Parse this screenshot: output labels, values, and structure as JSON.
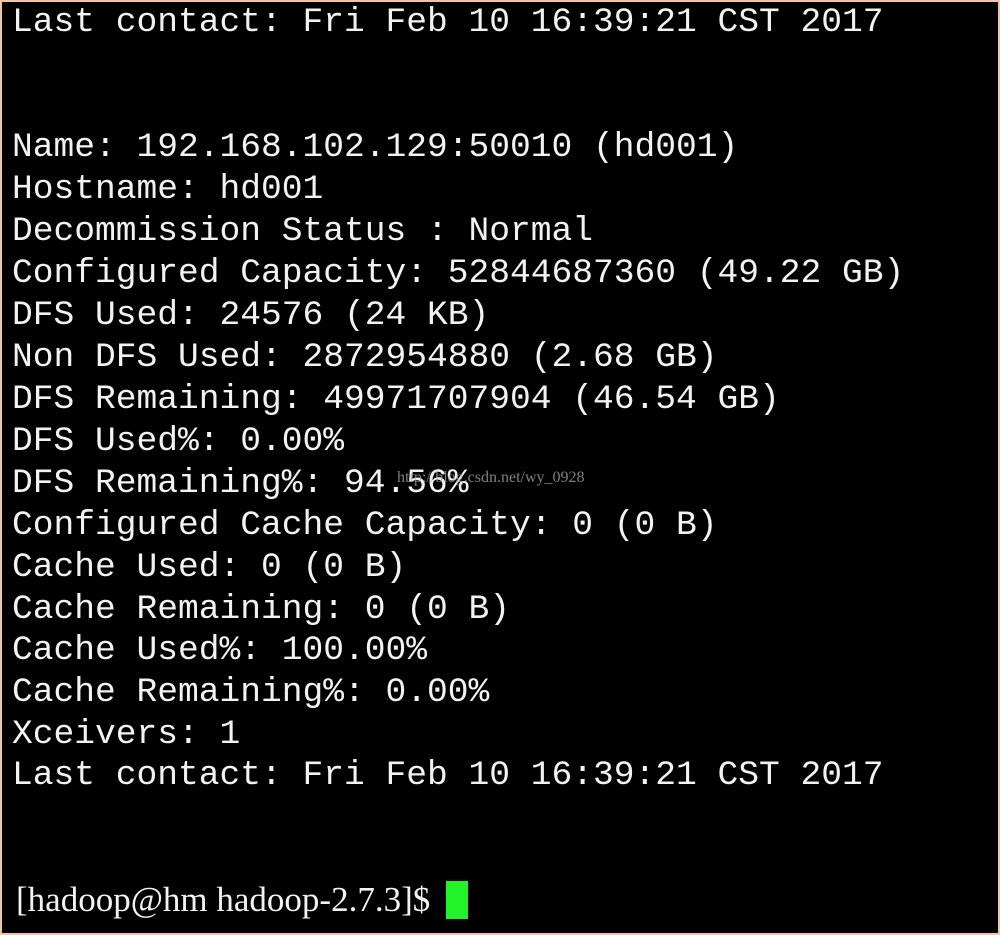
{
  "terminal": {
    "lines": [
      "Last contact: Fri Feb 10 16:39:21 CST 2017",
      "",
      "",
      "Name: 192.168.102.129:50010 (hd001)",
      "Hostname: hd001",
      "Decommission Status : Normal",
      "Configured Capacity: 52844687360 (49.22 GB)",
      "DFS Used: 24576 (24 KB)",
      "Non DFS Used: 2872954880 (2.68 GB)",
      "DFS Remaining: 49971707904 (46.54 GB)",
      "DFS Used%: 0.00%",
      "DFS Remaining%: 94.56%",
      "Configured Cache Capacity: 0 (0 B)",
      "Cache Used: 0 (0 B)",
      "Cache Remaining: 0 (0 B)",
      "Cache Used%: 100.00%",
      "Cache Remaining%: 0.00%",
      "Xceivers: 1",
      "Last contact: Fri Feb 10 16:39:21 CST 2017"
    ],
    "prompt": "[hadoop@hm hadoop-2.7.3]$",
    "cursor_color": "#22f22a"
  },
  "watermark": "http://blog.csdn.net/wy_0928"
}
